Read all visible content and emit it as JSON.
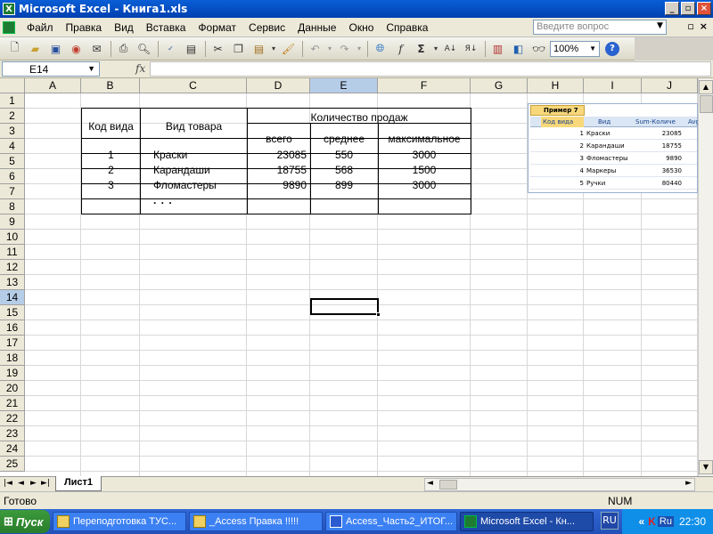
{
  "window": {
    "title": "Microsoft Excel - Книга1.xls",
    "minimize": "_",
    "restore": "▫",
    "close": "×"
  },
  "menu": {
    "items": [
      "Файл",
      "Правка",
      "Вид",
      "Вставка",
      "Формат",
      "Сервис",
      "Данные",
      "Окно",
      "Справка"
    ],
    "help_placeholder": "Введите вопрос"
  },
  "toolbar": {
    "zoom": "100%",
    "icons": [
      "new-icon",
      "open-icon",
      "save-icon",
      "permission-icon",
      "email-icon",
      "print-icon",
      "print-preview-icon",
      "spelling-icon",
      "research-icon",
      "cut-icon",
      "copy-icon",
      "paste-icon",
      "format-painter-icon",
      "undo-icon",
      "redo-icon",
      "hyperlink-icon",
      "function-icon",
      "autosum-icon",
      "sort-ascending-icon",
      "sort-descending-icon",
      "chart-wizard-icon",
      "drawing-icon",
      "find-icon",
      "help-icon"
    ]
  },
  "formula_bar": {
    "name_box": "E14",
    "fx_label": "fx",
    "formula": ""
  },
  "grid": {
    "columns": [
      "A",
      "B",
      "C",
      "D",
      "E",
      "F",
      "G",
      "H",
      "I",
      "J"
    ],
    "rows": [
      "1",
      "2",
      "3",
      "4",
      "5",
      "6",
      "7",
      "8",
      "9",
      "10",
      "11",
      "12",
      "13",
      "14",
      "15",
      "16",
      "17",
      "18",
      "19",
      "20",
      "21",
      "22",
      "23",
      "24",
      "25"
    ],
    "selected_cell": "E14"
  },
  "table": {
    "header_code": "Код вида",
    "header_product": "Вид товара",
    "header_sales": "Количество продаж",
    "sub_total": "всего",
    "sub_avg": "среднее",
    "sub_max": "максимальное",
    "rows": [
      {
        "code": "1",
        "product": "Краски",
        "total": "23085",
        "avg": "550",
        "max": "3000"
      },
      {
        "code": "2",
        "product": "Карандаши",
        "total": "18755",
        "avg": "568",
        "max": "1500"
      },
      {
        "code": "3",
        "product": "Фломастеры",
        "total": "9890",
        "avg": "899",
        "max": "3000"
      }
    ],
    "ellipsis": ". . ."
  },
  "preview": {
    "tab": "Пример 7",
    "col_code": "Код вида",
    "col_kind": "Вид",
    "col_sum": "Sum-Количе",
    "col_avg": "Avg",
    "rows": [
      {
        "code": "1",
        "kind": "Краски",
        "sum": "23085"
      },
      {
        "code": "2",
        "kind": "Карандаши",
        "sum": "18755"
      },
      {
        "code": "3",
        "kind": "Фломастеры",
        "sum": "9890"
      },
      {
        "code": "4",
        "kind": "Маркеры",
        "sum": "36530"
      },
      {
        "code": "5",
        "kind": "Ручки",
        "sum": "80440"
      }
    ]
  },
  "sheet_tabs": {
    "active": "Лист1"
  },
  "status": {
    "ready": "Готово",
    "num": "NUM"
  },
  "taskbar": {
    "start": "Пуск",
    "tasks": [
      "Переподготовка ТУС...",
      "_Access Правка !!!!!",
      "Access_Часть2_ИТОГ...",
      "Microsoft Excel - Кн..."
    ],
    "lang": "RU",
    "tray_lang": "Ru",
    "clock": "22:30"
  }
}
